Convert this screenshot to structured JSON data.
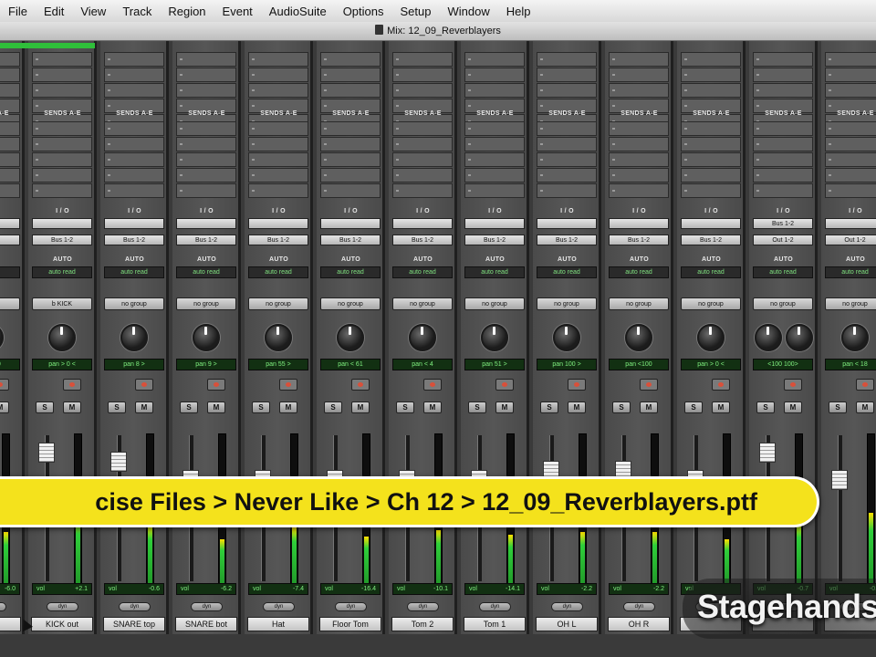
{
  "menubar": {
    "items": [
      "File",
      "Edit",
      "View",
      "Track",
      "Region",
      "Event",
      "AudioSuite",
      "Options",
      "Setup",
      "Window",
      "Help"
    ]
  },
  "window": {
    "title": "Mix: 12_09_Reverblayers"
  },
  "labels": {
    "sends": "SENDS A-E",
    "io": "I / O",
    "auto": "AUTO",
    "solo": "S",
    "mute": "M",
    "vol": "vol",
    "dyn": "dyn"
  },
  "channels": [
    {
      "name": "ho",
      "input": "",
      "output": "",
      "automation": "",
      "group": "",
      "pan": "pan > 0",
      "volume": "-6.0"
    },
    {
      "name": "KICK out",
      "input": "",
      "output": "Bus 1-2",
      "automation": "auto read",
      "group": "b KICK",
      "pan": "pan > 0 <",
      "volume": "+2.1"
    },
    {
      "name": "SNARE top",
      "input": "",
      "output": "Bus 1-2",
      "automation": "auto read",
      "group": "no group",
      "pan": "pan 8 >",
      "volume": "-0.6"
    },
    {
      "name": "SNARE bot",
      "input": "",
      "output": "Bus 1-2",
      "automation": "auto read",
      "group": "no group",
      "pan": "pan 9 >",
      "volume": "-6.2"
    },
    {
      "name": "Hat",
      "input": "",
      "output": "Bus 1-2",
      "automation": "auto read",
      "group": "no group",
      "pan": "pan 55 >",
      "volume": "-7.4"
    },
    {
      "name": "Floor Tom",
      "input": "",
      "output": "Bus 1-2",
      "automation": "auto read",
      "group": "no group",
      "pan": "pan < 61",
      "volume": "-16.4"
    },
    {
      "name": "Tom 2",
      "input": "",
      "output": "Bus 1-2",
      "automation": "auto read",
      "group": "no group",
      "pan": "pan < 4",
      "volume": "-10.1"
    },
    {
      "name": "Tom 1",
      "input": "",
      "output": "Bus 1-2",
      "automation": "auto read",
      "group": "no group",
      "pan": "pan 51 >",
      "volume": "-14.1"
    },
    {
      "name": "OH L",
      "input": "",
      "output": "Bus 1-2",
      "automation": "auto read",
      "group": "no group",
      "pan": "pan 100 >",
      "volume": "-2.2"
    },
    {
      "name": "OH R",
      "input": "",
      "output": "Bus 1-2",
      "automation": "auto read",
      "group": "no group",
      "pan": "pan <100",
      "volume": "-2.2"
    },
    {
      "name": "",
      "input": "",
      "output": "Bus 1-2",
      "automation": "auto read",
      "group": "no group",
      "pan": "pan > 0 <",
      "volume": ""
    },
    {
      "name": "",
      "input": "Bus 1-2",
      "output": "Out 1-2",
      "automation": "auto read",
      "group": "no group",
      "pan": "<100 100>",
      "volume": "-0.7"
    },
    {
      "name": "",
      "input": "",
      "output": "Out 1-2",
      "automation": "auto read",
      "group": "no group",
      "pan": "pan < 18",
      "volume": "-0.0"
    }
  ],
  "path_banner": {
    "text": "cise Files > Never Like > Ch 12 > 12_09_Reverblayers.ptf"
  },
  "watermark": {
    "text": "Stagehandsp"
  },
  "colors": {
    "banner": "#f4e21c",
    "readout_text": "#7ff07f",
    "strip": "#4f4f4f"
  }
}
